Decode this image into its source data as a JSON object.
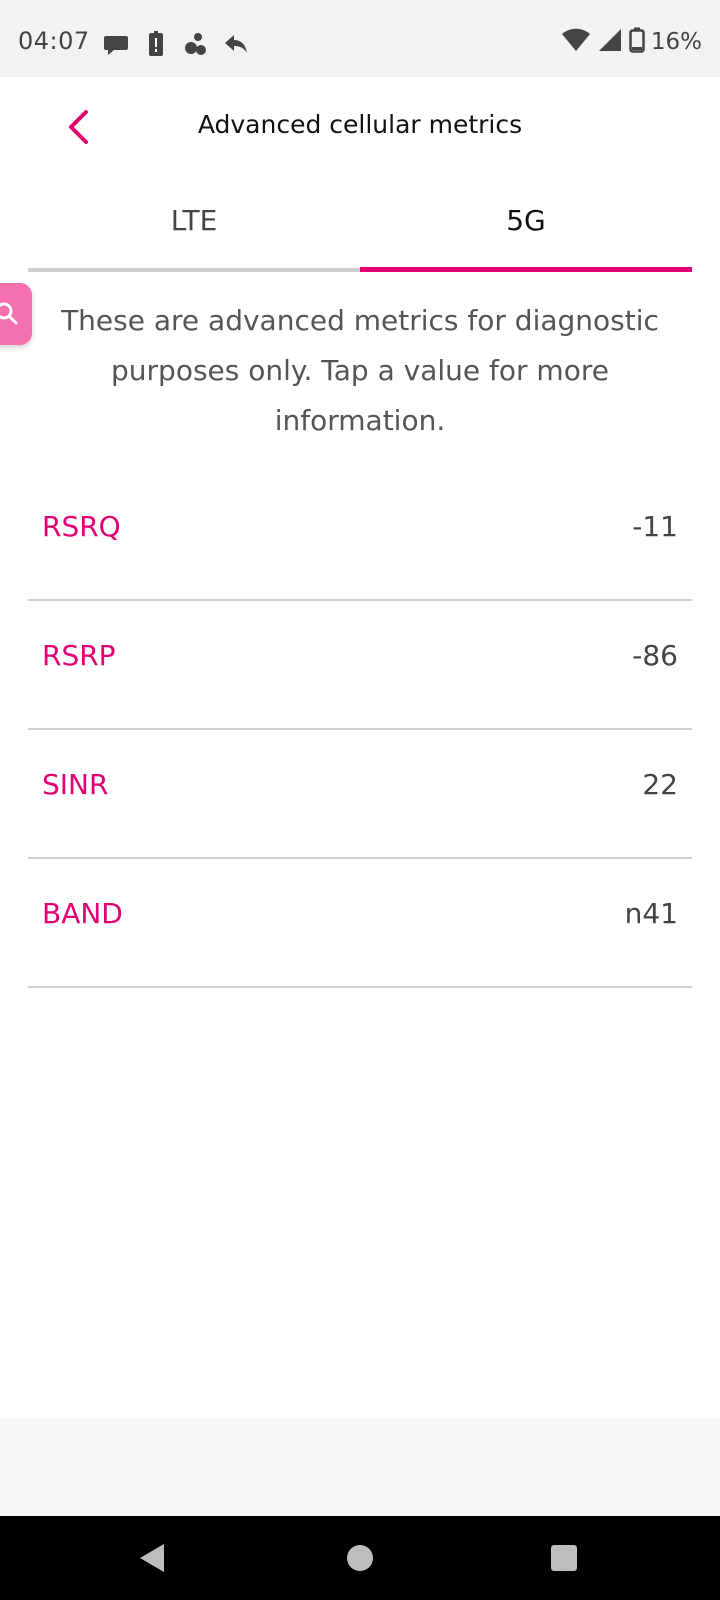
{
  "status_bar": {
    "time": "04:07",
    "battery": "16%",
    "left_icons": [
      "message-bubble-icon",
      "alert-battery-icon",
      "app-notification-icon",
      "reply-icon"
    ],
    "right_icons": [
      "wifi-icon",
      "cell-signal-icon",
      "battery-icon"
    ]
  },
  "header": {
    "title": "Advanced cellular metrics",
    "back_icon": "chevron-left-icon"
  },
  "tabs": [
    {
      "label": "LTE",
      "selected": false
    },
    {
      "label": "5G",
      "selected": true
    }
  ],
  "description": "These are advanced metrics for diagnostic purposes only. Tap a value for more information.",
  "metrics": [
    {
      "label": "RSRQ",
      "value": "-11"
    },
    {
      "label": "RSRP",
      "value": "-86"
    },
    {
      "label": "SINR",
      "value": "22"
    },
    {
      "label": "BAND",
      "value": "n41"
    }
  ],
  "colors": {
    "accent": "#e20074",
    "floating_button": "#f46fae",
    "status_bar_bg": "#f2f2f2",
    "nav_bar_bg": "#000000"
  },
  "nav_bar": [
    "back-triangle-icon",
    "home-circle-icon",
    "recents-square-icon"
  ]
}
